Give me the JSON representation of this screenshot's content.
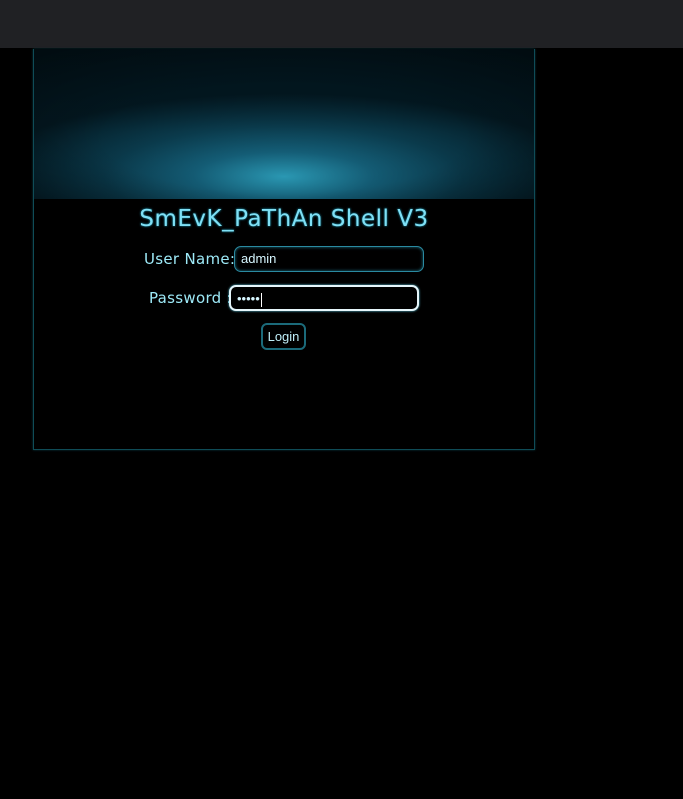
{
  "header": {
    "title": "SmEvK_PaThAn Shell V3"
  },
  "form": {
    "username_label": "User Name:",
    "username_value": "admin",
    "password_label": "Password :",
    "password_masked": "•••••",
    "login_label": "Login"
  },
  "colors": {
    "background": "#000000",
    "topbar": "#202124",
    "accent": "#7fe0f5",
    "border": "#1b6a7a"
  }
}
